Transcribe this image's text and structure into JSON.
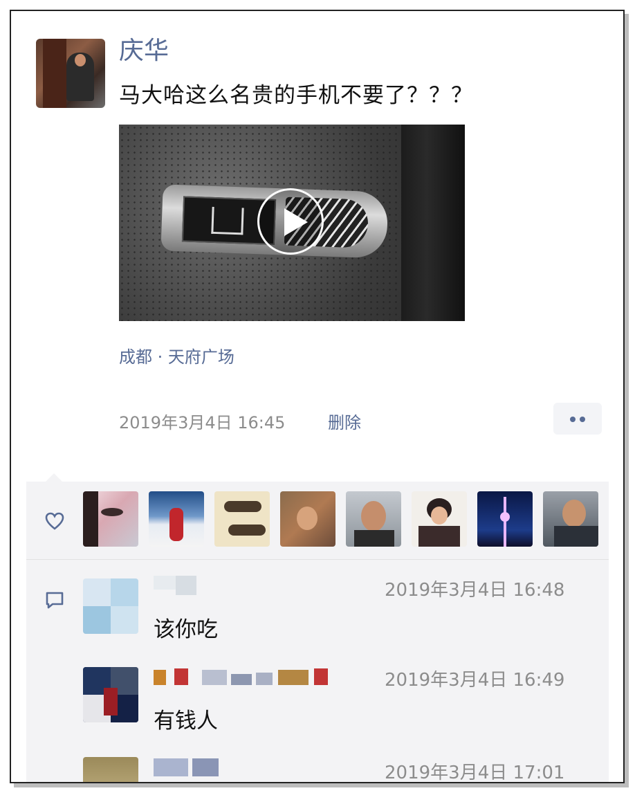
{
  "post": {
    "author": "庆华",
    "text": "马大哈这么名贵的手机不要了？？？",
    "location": "成都 · 天府广场",
    "time": "2019年3月4日 16:45",
    "delete_label": "删除"
  },
  "comments": [
    {
      "text": "该你吃",
      "time": "2019年3月4日 16:48"
    },
    {
      "text": "有钱人",
      "time": "2019年3月4日 16:49"
    },
    {
      "text": "",
      "time": "2019年3月4日 17:01"
    }
  ],
  "colors": {
    "link": "#576b95",
    "meta": "#8c8c8c",
    "panel": "#f3f3f5"
  },
  "icons": {
    "like": "heart-outline-icon",
    "comment": "speech-bubble-icon",
    "more": "two-dots-icon",
    "video": "play-icon"
  }
}
